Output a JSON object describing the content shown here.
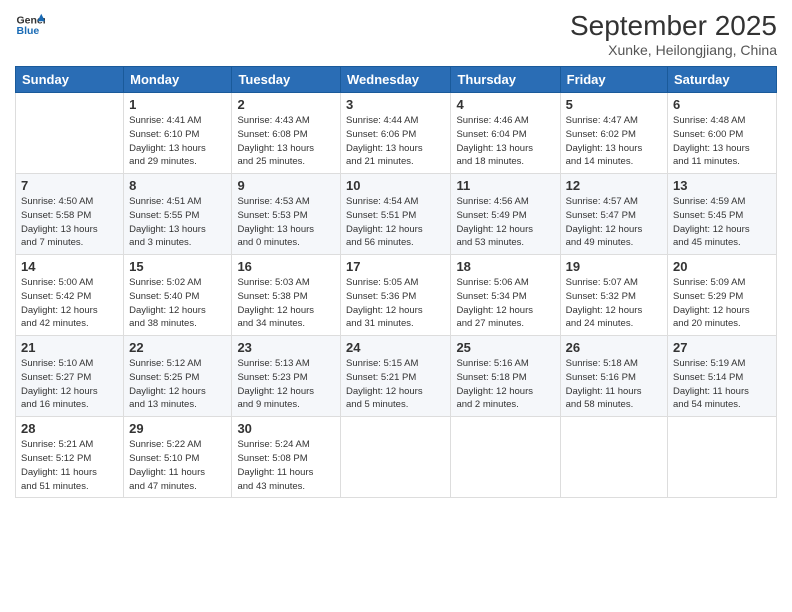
{
  "header": {
    "logo_line1": "General",
    "logo_line2": "Blue",
    "month_year": "September 2025",
    "location": "Xunke, Heilongjiang, China"
  },
  "weekdays": [
    "Sunday",
    "Monday",
    "Tuesday",
    "Wednesday",
    "Thursday",
    "Friday",
    "Saturday"
  ],
  "weeks": [
    [
      {
        "day": "",
        "info": ""
      },
      {
        "day": "1",
        "info": "Sunrise: 4:41 AM\nSunset: 6:10 PM\nDaylight: 13 hours\nand 29 minutes."
      },
      {
        "day": "2",
        "info": "Sunrise: 4:43 AM\nSunset: 6:08 PM\nDaylight: 13 hours\nand 25 minutes."
      },
      {
        "day": "3",
        "info": "Sunrise: 4:44 AM\nSunset: 6:06 PM\nDaylight: 13 hours\nand 21 minutes."
      },
      {
        "day": "4",
        "info": "Sunrise: 4:46 AM\nSunset: 6:04 PM\nDaylight: 13 hours\nand 18 minutes."
      },
      {
        "day": "5",
        "info": "Sunrise: 4:47 AM\nSunset: 6:02 PM\nDaylight: 13 hours\nand 14 minutes."
      },
      {
        "day": "6",
        "info": "Sunrise: 4:48 AM\nSunset: 6:00 PM\nDaylight: 13 hours\nand 11 minutes."
      }
    ],
    [
      {
        "day": "7",
        "info": "Sunrise: 4:50 AM\nSunset: 5:58 PM\nDaylight: 13 hours\nand 7 minutes."
      },
      {
        "day": "8",
        "info": "Sunrise: 4:51 AM\nSunset: 5:55 PM\nDaylight: 13 hours\nand 3 minutes."
      },
      {
        "day": "9",
        "info": "Sunrise: 4:53 AM\nSunset: 5:53 PM\nDaylight: 13 hours\nand 0 minutes."
      },
      {
        "day": "10",
        "info": "Sunrise: 4:54 AM\nSunset: 5:51 PM\nDaylight: 12 hours\nand 56 minutes."
      },
      {
        "day": "11",
        "info": "Sunrise: 4:56 AM\nSunset: 5:49 PM\nDaylight: 12 hours\nand 53 minutes."
      },
      {
        "day": "12",
        "info": "Sunrise: 4:57 AM\nSunset: 5:47 PM\nDaylight: 12 hours\nand 49 minutes."
      },
      {
        "day": "13",
        "info": "Sunrise: 4:59 AM\nSunset: 5:45 PM\nDaylight: 12 hours\nand 45 minutes."
      }
    ],
    [
      {
        "day": "14",
        "info": "Sunrise: 5:00 AM\nSunset: 5:42 PM\nDaylight: 12 hours\nand 42 minutes."
      },
      {
        "day": "15",
        "info": "Sunrise: 5:02 AM\nSunset: 5:40 PM\nDaylight: 12 hours\nand 38 minutes."
      },
      {
        "day": "16",
        "info": "Sunrise: 5:03 AM\nSunset: 5:38 PM\nDaylight: 12 hours\nand 34 minutes."
      },
      {
        "day": "17",
        "info": "Sunrise: 5:05 AM\nSunset: 5:36 PM\nDaylight: 12 hours\nand 31 minutes."
      },
      {
        "day": "18",
        "info": "Sunrise: 5:06 AM\nSunset: 5:34 PM\nDaylight: 12 hours\nand 27 minutes."
      },
      {
        "day": "19",
        "info": "Sunrise: 5:07 AM\nSunset: 5:32 PM\nDaylight: 12 hours\nand 24 minutes."
      },
      {
        "day": "20",
        "info": "Sunrise: 5:09 AM\nSunset: 5:29 PM\nDaylight: 12 hours\nand 20 minutes."
      }
    ],
    [
      {
        "day": "21",
        "info": "Sunrise: 5:10 AM\nSunset: 5:27 PM\nDaylight: 12 hours\nand 16 minutes."
      },
      {
        "day": "22",
        "info": "Sunrise: 5:12 AM\nSunset: 5:25 PM\nDaylight: 12 hours\nand 13 minutes."
      },
      {
        "day": "23",
        "info": "Sunrise: 5:13 AM\nSunset: 5:23 PM\nDaylight: 12 hours\nand 9 minutes."
      },
      {
        "day": "24",
        "info": "Sunrise: 5:15 AM\nSunset: 5:21 PM\nDaylight: 12 hours\nand 5 minutes."
      },
      {
        "day": "25",
        "info": "Sunrise: 5:16 AM\nSunset: 5:18 PM\nDaylight: 12 hours\nand 2 minutes."
      },
      {
        "day": "26",
        "info": "Sunrise: 5:18 AM\nSunset: 5:16 PM\nDaylight: 11 hours\nand 58 minutes."
      },
      {
        "day": "27",
        "info": "Sunrise: 5:19 AM\nSunset: 5:14 PM\nDaylight: 11 hours\nand 54 minutes."
      }
    ],
    [
      {
        "day": "28",
        "info": "Sunrise: 5:21 AM\nSunset: 5:12 PM\nDaylight: 11 hours\nand 51 minutes."
      },
      {
        "day": "29",
        "info": "Sunrise: 5:22 AM\nSunset: 5:10 PM\nDaylight: 11 hours\nand 47 minutes."
      },
      {
        "day": "30",
        "info": "Sunrise: 5:24 AM\nSunset: 5:08 PM\nDaylight: 11 hours\nand 43 minutes."
      },
      {
        "day": "",
        "info": ""
      },
      {
        "day": "",
        "info": ""
      },
      {
        "day": "",
        "info": ""
      },
      {
        "day": "",
        "info": ""
      }
    ]
  ]
}
